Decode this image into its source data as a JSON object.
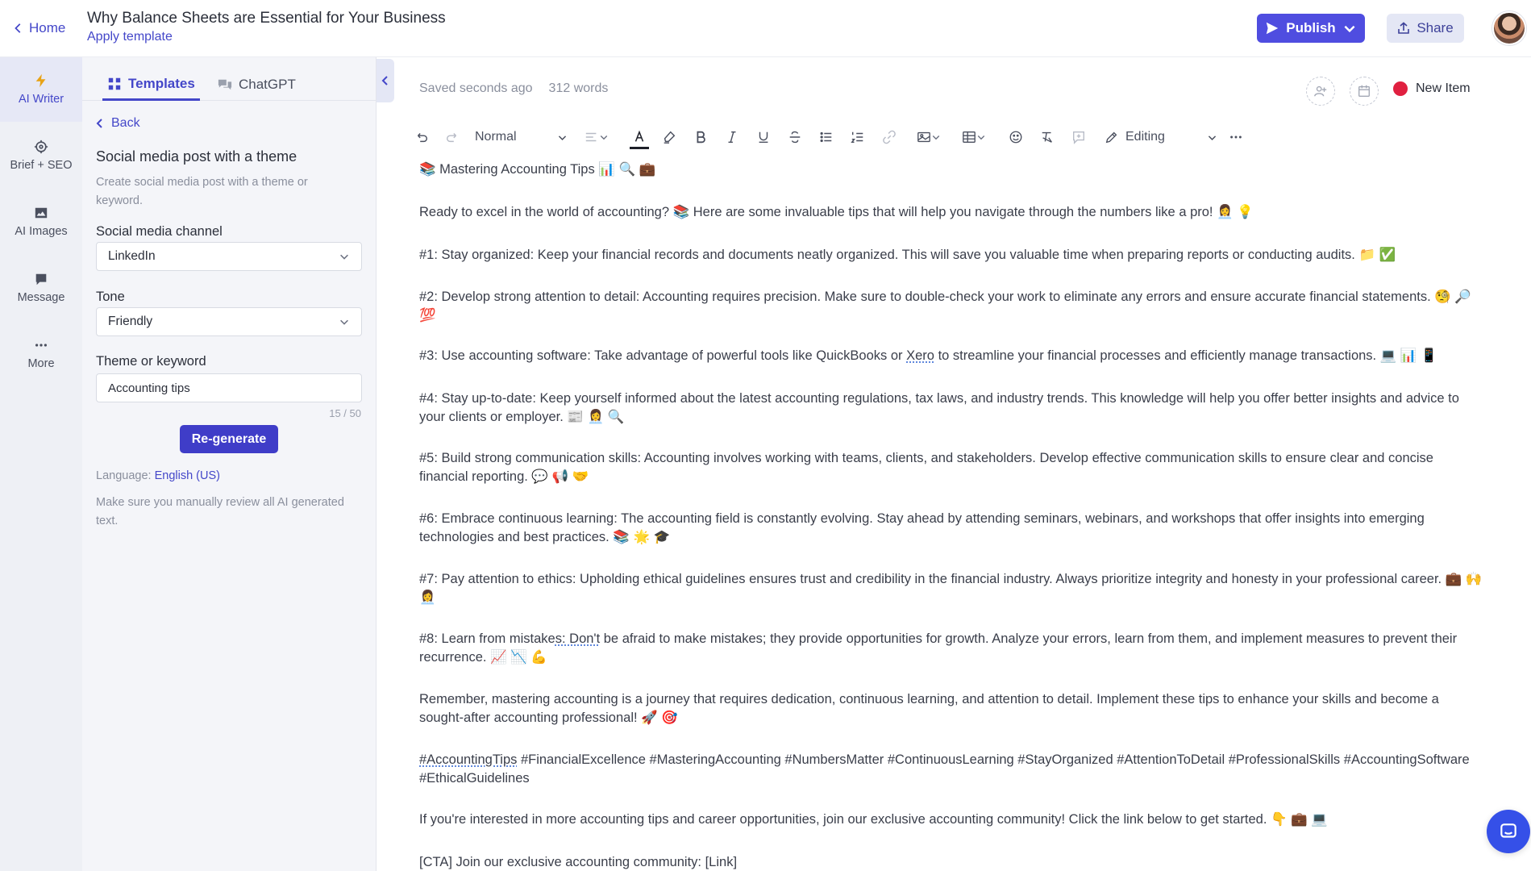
{
  "header": {
    "home_label": "Home",
    "doc_title": "Why Balance Sheets are Essential for Your Business",
    "apply_template": "Apply template",
    "publish_label": "Publish",
    "share_label": "Share"
  },
  "rail": {
    "items": [
      {
        "label": "AI Writer",
        "icon": "lightning-icon"
      },
      {
        "label": "Brief + SEO",
        "icon": "target-icon"
      },
      {
        "label": "AI Images",
        "icon": "image-icon"
      },
      {
        "label": "Message",
        "icon": "message-icon"
      },
      {
        "label": "More",
        "icon": "more-dots-icon"
      }
    ]
  },
  "panel": {
    "tabs": [
      {
        "label": "Templates",
        "icon": "templates-icon"
      },
      {
        "label": "ChatGPT",
        "icon": "chat-icon"
      }
    ],
    "back_label": "Back",
    "template_title": "Social media post with a theme",
    "template_desc": "Create social media post with a theme or keyword.",
    "channel_label": "Social media channel",
    "channel_value": "LinkedIn",
    "tone_label": "Tone",
    "tone_value": "Friendly",
    "theme_label": "Theme or keyword",
    "theme_value": "Accounting tips",
    "theme_counter": "15 / 50",
    "regenerate_label": "Re-generate",
    "language_prefix": "Language:",
    "language_value": "English (US)",
    "review_note": "Make sure you manually review all AI generated text."
  },
  "editor": {
    "saved_status": "Saved seconds ago",
    "word_count": "312 words",
    "new_item_label": "New Item",
    "style_value": "Normal",
    "mode_value": "Editing",
    "paragraphs": {
      "p0": "📚 Mastering Accounting Tips 📊 🔍 💼",
      "p1": "Ready to excel in the world of accounting? 📚 Here are some invaluable tips that will help you navigate through the numbers like a pro! 👩‍💼 💡",
      "p2": "#1: Stay organized: Keep your financial records and documents neatly organized. This will save you valuable time when preparing reports or conducting audits. 📁 ✅",
      "p3": "#2: Develop strong attention to detail: Accounting requires precision. Make sure to double-check your work to eliminate any errors and ensure accurate financial statements. 🧐 🔎 💯",
      "p4a": "#3: Use accounting software: Take advantage of powerful tools like QuickBooks or ",
      "p4b": "Xero",
      "p4c": " to streamline your financial processes and efficiently manage transactions. 💻 📊 📱",
      "p5": "#4: Stay up-to-date: Keep yourself informed about the latest accounting regulations, tax laws, and industry trends. This knowledge will help you offer better insights and advice to your clients or employer. 📰 👩‍💼 🔍",
      "p6": "#5: Build strong communication skills: Accounting involves working with teams, clients, and stakeholders. Develop effective communication skills to ensure clear and concise financial reporting. 💬 📢 🤝",
      "p7": "#6: Embrace continuous learning: The accounting field is constantly evolving. Stay ahead by attending seminars, webinars, and workshops that offer insights into emerging technologies and best practices. 📚 🌟 🎓",
      "p8": "#7: Pay attention to ethics: Upholding ethical guidelines ensures trust and credibility in the financial industry. Always prioritize integrity and honesty in your professional career. 💼 🙌 👩‍💼",
      "p9a": "#8: Learn from mistake",
      "p9b": "s: Don't",
      "p9c": " be afraid to make mistakes; they provide opportunities for growth. Analyze your errors, learn from them, and implement measures to prevent their recurrence. 📈 📉 💪",
      "p10": "Remember, mastering accounting is a journey that requires dedication, continuous learning, and attention to detail. Implement these tips to enhance your skills and become a sought-after accounting professional! 🚀 🎯",
      "p11a": "#AccountingTips",
      "p11b": " #FinancialExcellence #MasteringAccounting #NumbersMatter #ContinuousLearning #StayOrganized #AttentionToDetail #ProfessionalSkills #AccountingSoftware #EthicalGuidelines",
      "p12": "If you're interested in more accounting tips and career opportunities, join our exclusive accounting community! Click the link below to get started. 👇 💼 💻",
      "p13": "[CTA] Join our exclusive accounting community: [Link]"
    }
  },
  "colors": {
    "accent": "#4447c9",
    "publish_bg": "#4f4de0",
    "status_dot": "#e02040",
    "chat_bubble": "#3550e8"
  }
}
